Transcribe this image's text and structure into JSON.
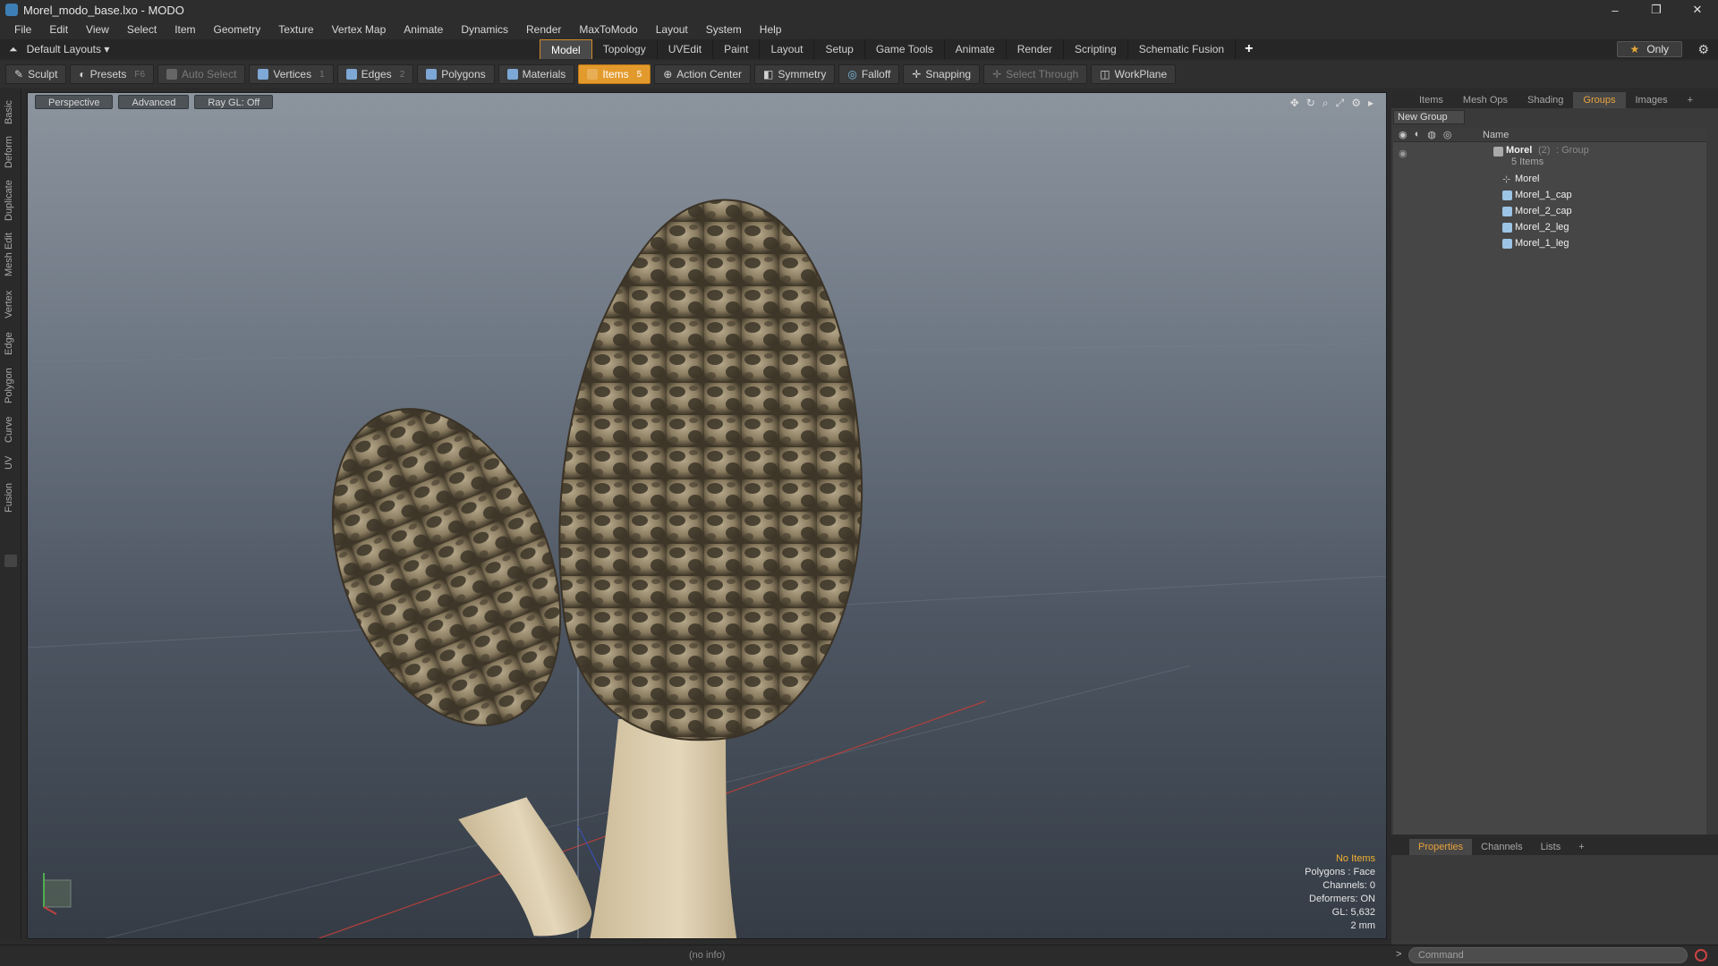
{
  "window": {
    "title": "Morel_modo_base.lxo - MODO",
    "minimize": "–",
    "maximize": "❐",
    "close": "✕"
  },
  "menu": [
    "File",
    "Edit",
    "View",
    "Select",
    "Item",
    "Geometry",
    "Texture",
    "Vertex Map",
    "Animate",
    "Dynamics",
    "Render",
    "MaxToModo",
    "Layout",
    "System",
    "Help"
  ],
  "layout": {
    "selector": "Default Layouts ▾",
    "only_label": "Only",
    "star": "★",
    "gear": "⚙"
  },
  "tabs": [
    "Model",
    "Topology",
    "UVEdit",
    "Paint",
    "Layout",
    "Setup",
    "Game Tools",
    "Animate",
    "Render",
    "Scripting",
    "Schematic Fusion"
  ],
  "active_tab": "Model",
  "tab_add": "+",
  "toolbar": {
    "sculpt": "Sculpt",
    "presets": "Presets",
    "presets_key": "F6",
    "auto_select": "Auto Select",
    "vertices": "Vertices",
    "vertices_key": "1",
    "edges": "Edges",
    "edges_key": "2",
    "polygons": "Polygons",
    "materials": "Materials",
    "items": "Items",
    "items_key": "5",
    "action_center": "Action Center",
    "symmetry": "Symmetry",
    "falloff": "Falloff",
    "snapping": "Snapping",
    "select_through": "Select Through",
    "workplane": "WorkPlane"
  },
  "left_tabs": [
    "Basic",
    "Deform",
    "Duplicate",
    "Mesh Edit",
    "Vertex",
    "Edge",
    "Polygon",
    "Curve",
    "UV",
    "Fusion"
  ],
  "viewport": {
    "view": "Perspective",
    "mode": "Advanced",
    "ray_gl": "Ray GL: Off",
    "info": {
      "status": "No Items",
      "polygons": "Polygons : Face",
      "channels": "Channels: 0",
      "deformers": "Deformers: ON",
      "gl": "GL: 5,632",
      "scale": "2 mm"
    }
  },
  "right_panel": {
    "tabs": [
      "Items",
      "Mesh Ops",
      "Shading",
      "Groups",
      "Images"
    ],
    "active_tab": "Groups",
    "tab_add": "+",
    "new_group": "New Group",
    "column_name": "Name",
    "group": {
      "name": "Morel",
      "count": "(2)",
      "type": ": Group",
      "items": "5 Items"
    },
    "children": [
      "Morel",
      "Morel_1_cap",
      "Morel_2_cap",
      "Morel_2_leg",
      "Morel_1_leg"
    ]
  },
  "properties": {
    "tabs": [
      "Properties",
      "Channels",
      "Lists"
    ],
    "active_tab": "Properties",
    "tab_add": "+"
  },
  "status": {
    "info": "(no info)",
    "command_placeholder": "Command",
    "prompt": ">"
  }
}
